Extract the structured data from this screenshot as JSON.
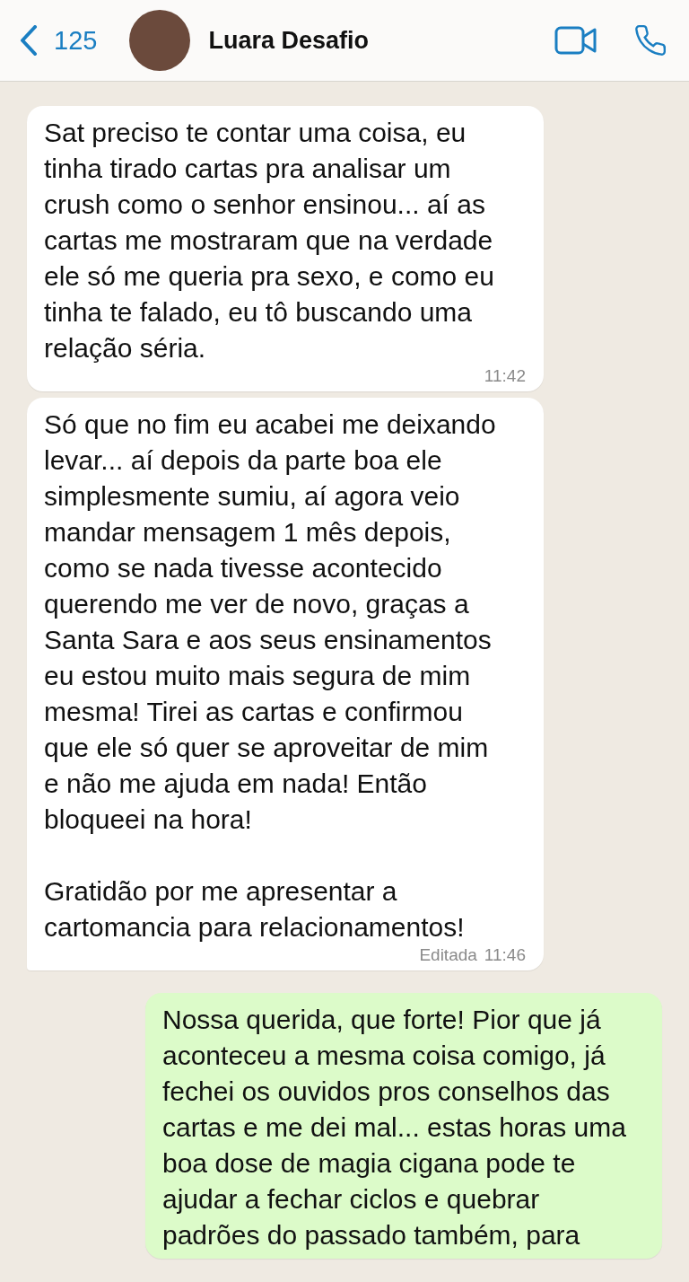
{
  "header": {
    "back_count": "125",
    "contact_name": "Luara Desafio"
  },
  "messages": [
    {
      "kind": "incoming",
      "text": "Sat preciso te contar uma coisa, eu\ntinha tirado cartas pra analisar um\ncrush como o senhor ensinou... aí as\ncartas me mostraram que na verdade\nele só me queria pra sexo, e como eu\ntinha te falado, eu tô buscando uma\nrelação séria.",
      "time": "11:42",
      "tail": false
    },
    {
      "kind": "incoming",
      "text": "Só que no fim eu acabei me deixando\nlevar... aí depois da parte boa ele\nsimplesmente sumiu, aí agora veio\nmandar mensagem 1 mês depois,\ncomo se nada tivesse acontecido\nquerendo me ver de novo, graças a\nSanta Sara e aos seus ensinamentos\neu estou muito mais segura de mim\nmesma! Tirei as cartas e confirmou\nque ele só quer se aproveitar de mim\ne não me ajuda em nada! Então\nbloqueei na hora!\n\nGratidão por me apresentar a\ncartomancia para relacionamentos!",
      "edited_label": "Editada",
      "time": "11:46",
      "tail": true
    },
    {
      "kind": "outgoing",
      "text": "Nossa querida, que forte! Pior que já\naconteceu a mesma coisa comigo, já\nfechei os ouvidos pros conselhos das\ncartas e me dei mal... estas horas uma\nboa dose de magia cigana pode te\najudar a fechar ciclos e quebrar\npadrões do passado também, para"
    }
  ]
}
